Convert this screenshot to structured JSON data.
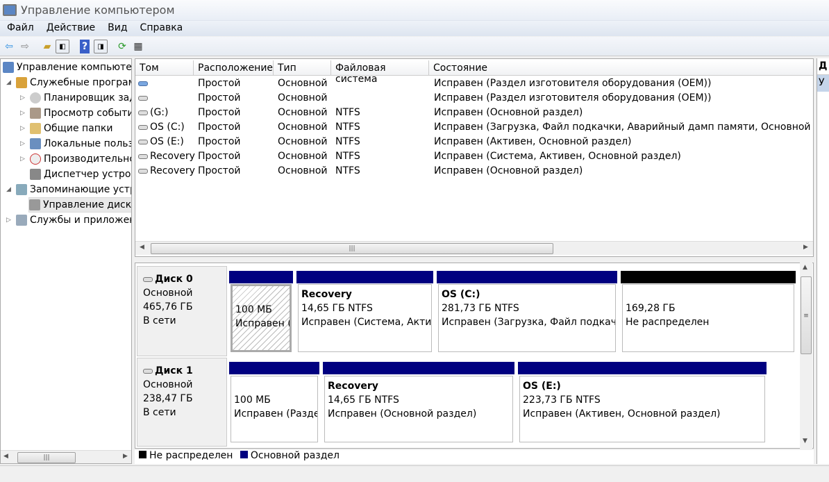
{
  "window": {
    "title": "Управление компьютером"
  },
  "menu": [
    "Файл",
    "Действие",
    "Вид",
    "Справка"
  ],
  "toolbar": [
    "back-icon",
    "forward-icon",
    "up-folder-icon",
    "show-hide-tree-icon",
    "help-icon",
    "show-hide-action-icon",
    "refresh-icon",
    "properties-icon"
  ],
  "tree": [
    {
      "label": "Управление компьютер",
      "level": 0,
      "arrow": ""
    },
    {
      "label": "Служебные програм",
      "level": 1,
      "arrow": "◢"
    },
    {
      "label": "Планировщик зад",
      "level": 2,
      "arrow": "▷"
    },
    {
      "label": "Просмотр событи",
      "level": 2,
      "arrow": "▷"
    },
    {
      "label": "Общие папки",
      "level": 2,
      "arrow": "▷"
    },
    {
      "label": "Локальные польз",
      "level": 2,
      "arrow": "▷"
    },
    {
      "label": "Производительнс",
      "level": 2,
      "arrow": "▷"
    },
    {
      "label": "Диспетчер устрой",
      "level": 2,
      "arrow": ""
    },
    {
      "label": "Запоминающие устр",
      "level": 1,
      "arrow": "◢"
    },
    {
      "label": "Управление диска",
      "level": 2,
      "arrow": ""
    },
    {
      "label": "Службы и приложен",
      "level": 1,
      "arrow": "▷"
    }
  ],
  "table": {
    "headers": [
      "Том",
      "Расположение",
      "Тип",
      "Файловая система",
      "Состояние"
    ],
    "rows": [
      [
        "",
        "Простой",
        "Основной",
        "",
        "Исправен (Раздел изготовителя оборудования (OEM))"
      ],
      [
        "",
        "Простой",
        "Основной",
        "",
        "Исправен (Раздел изготовителя оборудования (OEM))"
      ],
      [
        "(G:)",
        "Простой",
        "Основной",
        "NTFS",
        "Исправен (Основной раздел)"
      ],
      [
        "OS (C:)",
        "Простой",
        "Основной",
        "NTFS",
        "Исправен (Загрузка, Файл подкачки, Аварийный дамп памяти, Основной разд"
      ],
      [
        "OS (E:)",
        "Простой",
        "Основной",
        "NTFS",
        "Исправен (Активен, Основной раздел)"
      ],
      [
        "Recovery",
        "Простой",
        "Основной",
        "NTFS",
        "Исправен (Система, Активен, Основной раздел)"
      ],
      [
        "Recovery",
        "Простой",
        "Основной",
        "NTFS",
        "Исправен (Основной раздел)"
      ]
    ]
  },
  "disks": [
    {
      "name": "Диск 0",
      "type": "Основной",
      "size": "465,76 ГБ",
      "status": "В сети",
      "partitions": [
        {
          "name": "",
          "size": "100 МБ",
          "status": "Исправен (Р"
        },
        {
          "name": "Recovery",
          "size": "14,65 ГБ NTFS",
          "status": "Исправен (Система, Активе"
        },
        {
          "name": "OS  (C:)",
          "size": "281,73 ГБ NTFS",
          "status": "Исправен (Загрузка, Файл подкачки"
        },
        {
          "name": "",
          "size": "169,28 ГБ",
          "status": "Не распределен"
        }
      ]
    },
    {
      "name": "Диск 1",
      "type": "Основной",
      "size": "238,47 ГБ",
      "status": "В сети",
      "partitions": [
        {
          "name": "",
          "size": "100 МБ",
          "status": "Исправен (Разде."
        },
        {
          "name": "Recovery",
          "size": "14,65 ГБ NTFS",
          "status": "Исправен (Основной раздел)"
        },
        {
          "name": "OS  (E:)",
          "size": "223,73 ГБ NTFS",
          "status": "Исправен (Активен, Основной раздел)"
        }
      ]
    }
  ],
  "legend": [
    {
      "label": "Не распределен",
      "color": "#000000"
    },
    {
      "label": "Основной раздел",
      "color": "#000080"
    }
  ],
  "actions": {
    "header": "Д",
    "item": "У"
  }
}
